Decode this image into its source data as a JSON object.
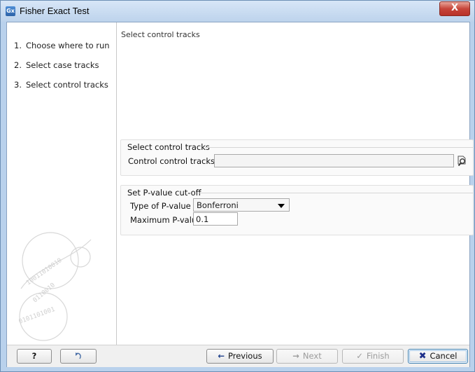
{
  "window": {
    "title": "Fisher Exact Test",
    "app_icon": "Gx",
    "close_label": "X"
  },
  "sidebar": {
    "steps": [
      {
        "num": "1.",
        "label": "Choose where to run"
      },
      {
        "num": "2.",
        "label": "Select case tracks"
      },
      {
        "num": "3.",
        "label": "Select control tracks"
      }
    ]
  },
  "main": {
    "header": "Select control tracks",
    "control_group": {
      "title": "Select control tracks",
      "field_label": "Control control tracks",
      "field_value": "",
      "browse_icon": "browse-icon"
    },
    "pvalue_group": {
      "title": "Set P-value cut-off",
      "type_label": "Type of P-value",
      "type_value": "Bonferroni",
      "max_label": "Maximum P-value",
      "max_value": "0.1"
    }
  },
  "footer": {
    "help_label": "?",
    "previous_label": "Previous",
    "next_label": "Next",
    "finish_label": "Finish",
    "cancel_label": "Cancel"
  }
}
